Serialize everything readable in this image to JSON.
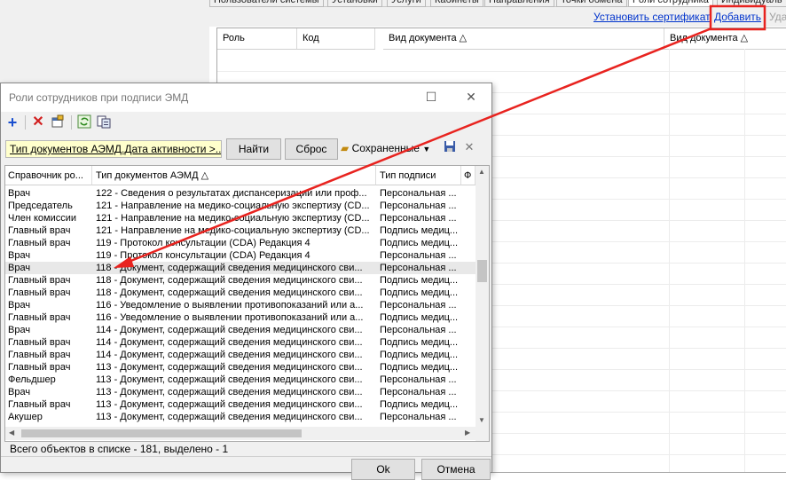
{
  "background": {
    "tabs": [
      "Пользователи системы",
      "Установки",
      "Услуги",
      "Кабинеты",
      "Направления",
      "Точки обмена",
      "Роли сотрудника",
      "Индивидуаль"
    ],
    "links": {
      "install_cert": "Установить сертификат",
      "add": "Добавить",
      "delete": "Уда"
    },
    "columns": [
      "Роль",
      "Код",
      "Вид документа",
      "Вид документа"
    ]
  },
  "dialog": {
    "title": "Роли сотрудников при подписи ЭМД",
    "window_buttons": {
      "maximize": "☐",
      "close": "✕"
    },
    "filter_text": "Тип документов АЭМД.Дата активности >...",
    "find_label": "Найти",
    "reset_label": "Сброс",
    "saved_label": "Сохраненные",
    "columns": [
      "Справочник ро...",
      "Тип документов АЭМД",
      "Тип подписи",
      "Ф"
    ],
    "rows": [
      [
        "Врач",
        "122 - Сведения о результатах диспансеризации или проф...",
        "Персональная ..."
      ],
      [
        "Председатель",
        "121 - Направление на медико-социальную экспертизу (CD...",
        "Персональная ..."
      ],
      [
        "Член комиссии",
        "121 - Направление на медико-социальную экспертизу (CD...",
        "Персональная ..."
      ],
      [
        "Главный врач",
        "121 - Направление на медико-социальную экспертизу (CD...",
        "Подпись медиц..."
      ],
      [
        "Главный врач",
        "119 - Протокол консультации (CDA) Редакция 4",
        "Подпись медиц..."
      ],
      [
        "Врач",
        "119 - Протокол консультации (CDA) Редакция 4",
        "Персональная ..."
      ],
      [
        "Врач",
        "118 - Документ, содержащий сведения медицинского сви...",
        "Персональная ..."
      ],
      [
        "Главный врач",
        "118 - Документ, содержащий сведения медицинского сви...",
        "Подпись медиц..."
      ],
      [
        "Главный врач",
        "118 - Документ, содержащий сведения медицинского сви...",
        "Подпись медиц..."
      ],
      [
        "Врач",
        "116 - Уведомление о выявлении противопоказаний или а...",
        "Персональная ..."
      ],
      [
        "Главный врач",
        "116 - Уведомление о выявлении противопоказаний или а...",
        "Подпись медиц..."
      ],
      [
        "Врач",
        "114 - Документ, содержащий сведения медицинского сви...",
        "Персональная ..."
      ],
      [
        "Главный врач",
        "114 - Документ, содержащий сведения медицинского сви...",
        "Подпись медиц..."
      ],
      [
        "Главный врач",
        "114 - Документ, содержащий сведения медицинского сви...",
        "Подпись медиц..."
      ],
      [
        "Главный врач",
        "113 - Документ, содержащий сведения медицинского сви...",
        "Подпись медиц..."
      ],
      [
        "Фельдшер",
        "113 - Документ, содержащий сведения медицинского сви...",
        "Персональная ..."
      ],
      [
        "Врач",
        "113 - Документ, содержащий сведения медицинского сви...",
        "Персональная ..."
      ],
      [
        "Главный врач",
        "113 - Документ, содержащий сведения медицинского сви...",
        "Подпись медиц..."
      ],
      [
        "Акушер",
        "113 - Документ, содержащий сведения медицинского сви...",
        "Персональная ..."
      ]
    ],
    "status": "Всего объектов в списке - 181, выделено - 1",
    "ok_label": "Ok",
    "cancel_label": "Отмена"
  },
  "colors": {
    "annotation": "#e8231f",
    "link": "#0033cc",
    "filter_bg": "#ffffcc"
  }
}
